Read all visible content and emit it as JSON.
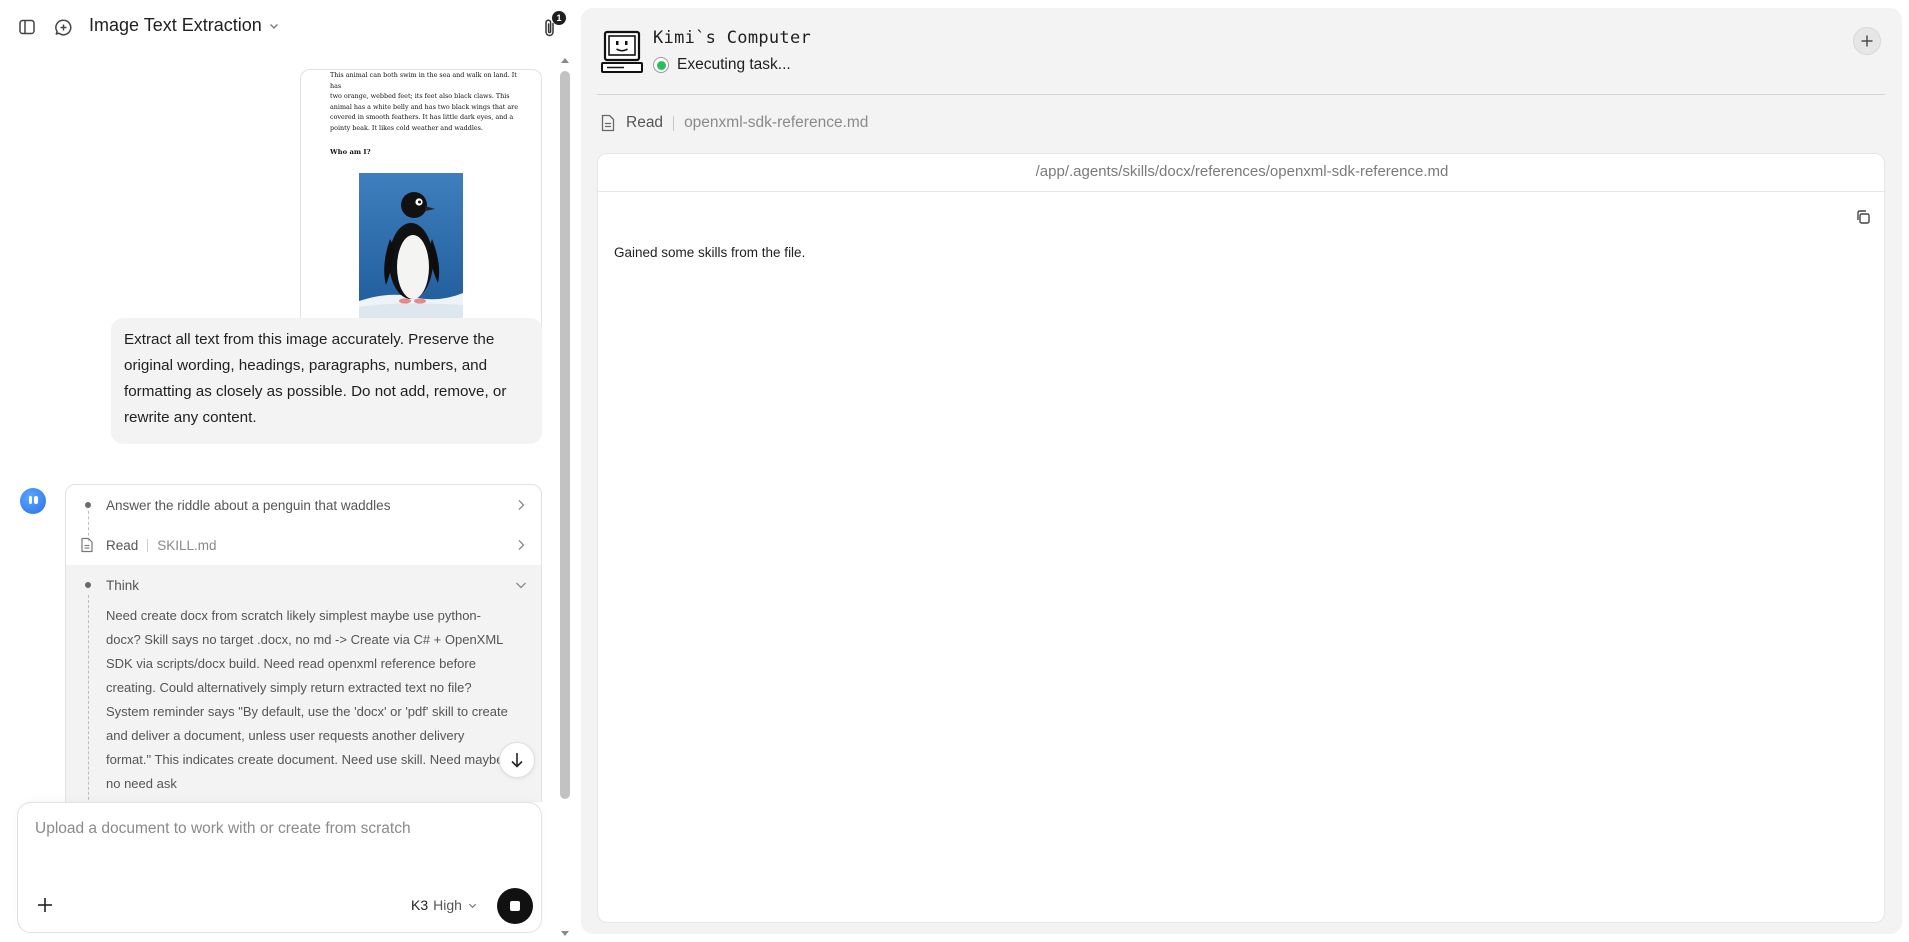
{
  "header": {
    "title": "Image Text Extraction",
    "attachments_count": "1"
  },
  "attachment": {
    "doc_lines": [
      "This animal can both swim in the sea and walk on land. It has",
      "two orange, webbed feet; its feet also black claws. This",
      "animal has a white belly and has two black wings that are",
      "covered in smooth feathers. It has little dark eyes, and a",
      "pointy beak. It likes cold weather and waddles."
    ],
    "question": "Who am I?"
  },
  "user_message": "Extract all text from this image accurately. Preserve the original wording, headings, paragraphs, numbers, and formatting as closely as possible. Do not add, remove, or rewrite any content.",
  "steps": {
    "task_label": "Answer the riddle about a penguin that waddles",
    "read_label": "Read",
    "read_file": "SKILL.md",
    "think_label": "Think",
    "think_text": "Need create docx from scratch likely simplest maybe use python-docx? Skill says no target .docx, no md -> Create via C# + OpenXML SDK via scripts/docx build. Need read openxml reference before creating. Could alternatively simply return extracted text no file? System reminder says \"By default, use the 'docx' or 'pdf' skill to create and deliver a document, unless user requests another delivery format.\" This indicates create document. Need use skill. Need maybe no need ask"
  },
  "composer": {
    "placeholder": "Upload a document to work with or create from scratch",
    "model_name": "K3",
    "model_mode": "High"
  },
  "computer": {
    "title": "Kimi`s Computer",
    "status": "Executing task...",
    "status_color": "#2bbf5a",
    "read_label": "Read",
    "read_file": "openxml-sdk-reference.md",
    "file_path": "/app/.agents/skills/docx/references/openxml-sdk-reference.md",
    "file_content": "Gained some skills from the file."
  }
}
